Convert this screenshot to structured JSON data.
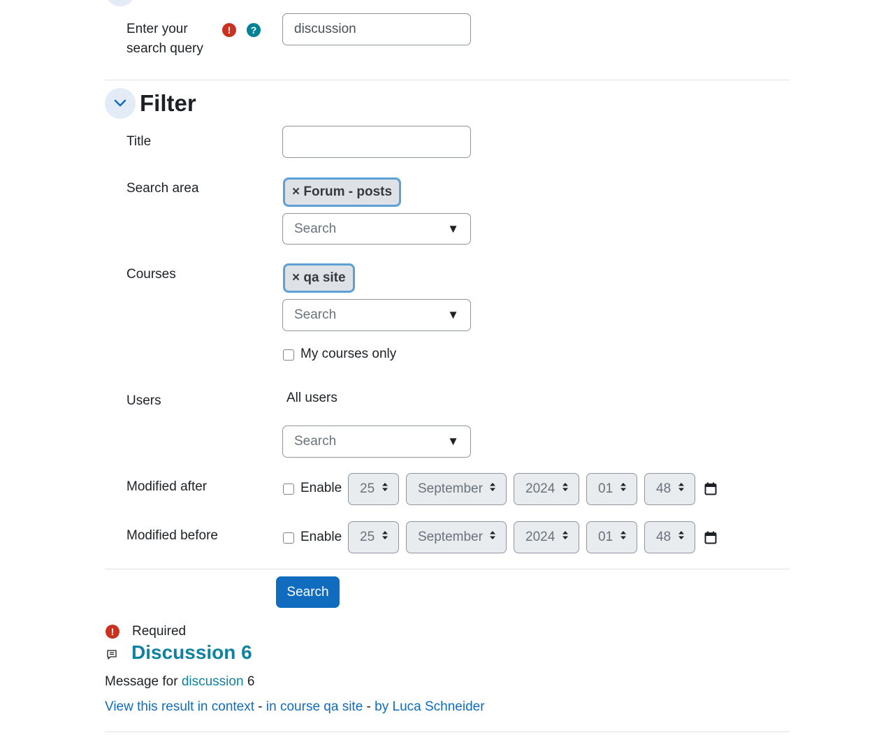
{
  "search": {
    "label": "Enter your search query",
    "value": "discussion"
  },
  "filter": {
    "heading": "Filter",
    "title_label": "Title",
    "title_value": "",
    "search_area": {
      "label": "Search area",
      "chip": "× Forum - posts",
      "placeholder": "Search"
    },
    "courses": {
      "label": "Courses",
      "chip": "× qa site",
      "placeholder": "Search",
      "my_courses_label": "My courses only"
    },
    "users": {
      "label": "Users",
      "value": "All users",
      "placeholder": "Search"
    },
    "modified_after": {
      "label": "Modified after",
      "enable_label": "Enable",
      "day": "25",
      "month": "September",
      "year": "2024",
      "hour": "01",
      "minute": "48"
    },
    "modified_before": {
      "label": "Modified before",
      "enable_label": "Enable",
      "day": "25",
      "month": "September",
      "year": "2024",
      "hour": "01",
      "minute": "48"
    }
  },
  "submit_label": "Search",
  "required_label": "Required",
  "result": {
    "title": "Discussion 6",
    "message_prefix": "Message for ",
    "message_link": "discussion",
    "message_suffix": " 6",
    "view_context": "View this result in context",
    "sep1": " - ",
    "in_course": "in course qa site",
    "sep2": " - ",
    "by_user": "by Luca Schneider"
  },
  "colors": {
    "primary": "#0f6cbf",
    "required": "#ca3120",
    "help": "#008196",
    "result_title": "#0f82a1"
  },
  "icons": {
    "required": "exclamation-circle",
    "help": "question-circle",
    "toggle": "chevron-down",
    "calendar": "calendar",
    "result": "forum-post"
  }
}
